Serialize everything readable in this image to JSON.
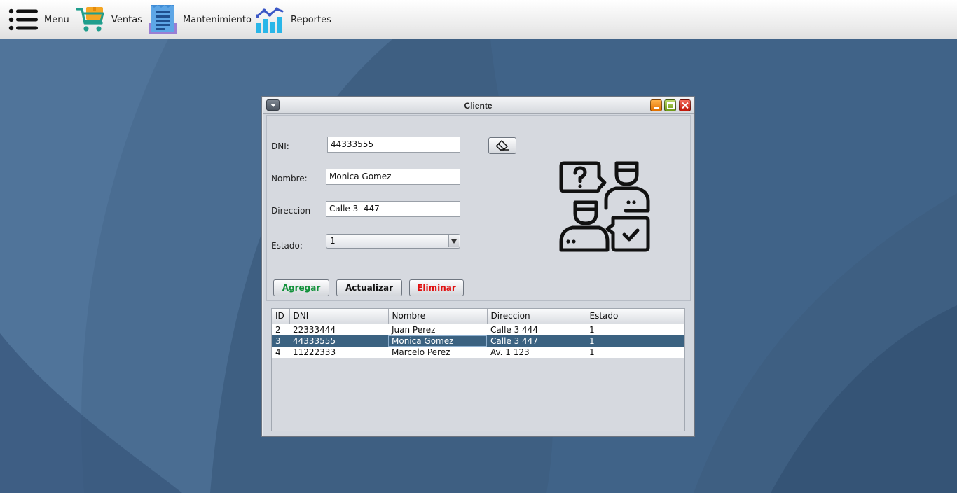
{
  "menubar": {
    "items": [
      {
        "label": "Menu",
        "icon": "hamburger-list-icon"
      },
      {
        "label": "Ventas",
        "icon": "shopping-cart-icon"
      },
      {
        "label": "Mantenimiento",
        "icon": "document-list-icon"
      },
      {
        "label": "Reportes",
        "icon": "bar-chart-icon"
      }
    ]
  },
  "window": {
    "title": "Cliente",
    "controls": [
      "minimize",
      "maximize",
      "close"
    ]
  },
  "form": {
    "dni_label": "DNI:",
    "dni_value": "44333555",
    "nombre_label": "Nombre:",
    "nombre_value": "Monica Gomez",
    "direccion_label": "Direccion",
    "direccion_value": "Calle 3  447",
    "estado_label": "Estado:",
    "estado_value": "1",
    "clear_icon": "eraser-icon",
    "illustration_icon": "customer-support-chat-icon"
  },
  "buttons": {
    "agregar": "Agregar",
    "actualizar": "Actualizar",
    "eliminar": "Eliminar"
  },
  "colors": {
    "agregar": "#11913a",
    "actualizar": "#111111",
    "eliminar": "#e01010",
    "selected_row": "#3b6281"
  },
  "table": {
    "columns": [
      "ID",
      "DNI",
      "Nombre",
      "Direccion",
      "Estado"
    ],
    "rows": [
      [
        "2",
        "22333444",
        "Juan Perez",
        "Calle 3 444",
        "1"
      ],
      [
        "3",
        "44333555",
        "Monica Gomez",
        "Calle 3  447",
        "1"
      ],
      [
        "4",
        "11222333",
        "Marcelo Perez",
        "Av. 1 123",
        "1"
      ]
    ],
    "selected_row_index": 1
  }
}
